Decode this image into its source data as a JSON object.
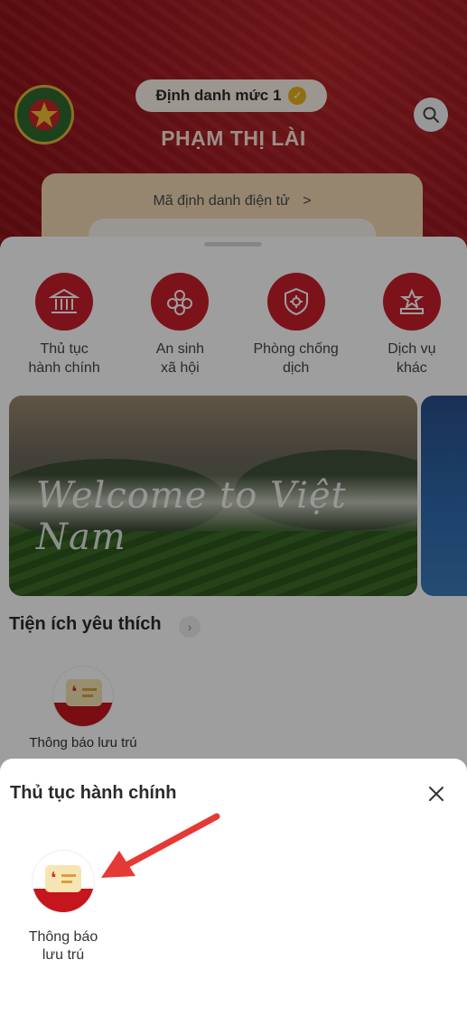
{
  "header": {
    "level_label": "Định danh mức 1",
    "user_name": "PHẠM THỊ LÀI",
    "id_card_label": "Mã định danh điện tử",
    "id_card_chevron": ">"
  },
  "services": [
    {
      "icon": "building-icon",
      "label": "Thủ tục\nhành chính"
    },
    {
      "icon": "social-security-icon",
      "label": "An sinh\nxã hội"
    },
    {
      "icon": "shield-virus-icon",
      "label": "Phòng chống\ndịch"
    },
    {
      "icon": "podium-star-icon",
      "label": "Dịch vụ\nkhác"
    }
  ],
  "banner": {
    "text": "Welcome to Việt Nam"
  },
  "favorites": {
    "title": "Tiện ích yêu thích",
    "more_glyph": "›",
    "items": [
      {
        "icon": "residence-notice-icon",
        "label": "Thông báo lưu trú"
      }
    ]
  },
  "sheet": {
    "title": "Thủ tục hành chính",
    "close_glyph": "✕",
    "items": [
      {
        "icon": "residence-notice-icon",
        "label_line1": "Thông báo",
        "label_line2": "lưu trú"
      }
    ]
  },
  "colors": {
    "brand_red": "#c8202a",
    "header_red": "#a21b22",
    "annotation_arrow": "#e53935"
  }
}
